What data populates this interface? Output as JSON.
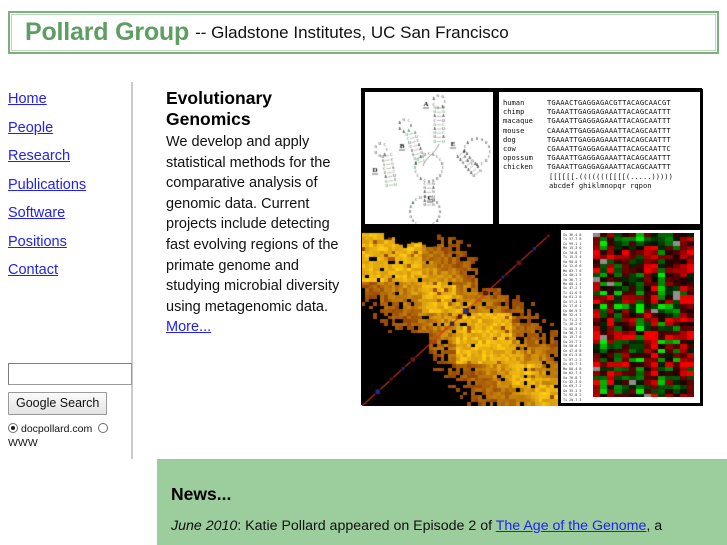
{
  "header": {
    "brand": "Pollard Group",
    "subtitle": "-- Gladstone Institutes, UC San Francisco",
    "border_color": "#7cb07f",
    "brand_color": "#5e9e63"
  },
  "sidebar": {
    "items": [
      {
        "label": "Home",
        "name": "home"
      },
      {
        "label": "People",
        "name": "people"
      },
      {
        "label": "Research",
        "name": "research"
      },
      {
        "label": "Publications",
        "name": "publications"
      },
      {
        "label": "Software",
        "name": "software"
      },
      {
        "label": "Positions",
        "name": "positions"
      },
      {
        "label": "Contact",
        "name": "contact"
      }
    ],
    "link_color": "#2222ee"
  },
  "search": {
    "value": "",
    "placeholder": "",
    "button_label": "Google Search",
    "scope_site_label": "docpollard.com",
    "scope_web_label": "WWW",
    "selected_scope": "docpollard.com"
  },
  "main": {
    "heading": "Evolutionary Genomics",
    "body": "We develop and apply statistical methods for the comparative analysis of genomic data. Current projects include detecting fast evolving regions of the primate genome and studying microbial diversity using metagenomic data.",
    "more_label": "More..."
  },
  "figure": {
    "rna_panel": {
      "caption": "rna-secondary-structure-diagram",
      "stem_labels": [
        "A",
        "B",
        "C",
        "D"
      ]
    },
    "alignment_panel": {
      "rows": [
        {
          "species": "human",
          "sequence": "TGAAACTGAGGAGACGTTACAGCAACGT"
        },
        {
          "species": "chimp",
          "sequence": "TGAAATTGAGGAGAAATTACAGCAATTT"
        },
        {
          "species": "macaque",
          "sequence": "TGAAATTGAGGAGAAATTACAGCAATTT"
        },
        {
          "species": "mouse",
          "sequence": "CAAAATTGAGGAGAAATTACAGCAATTT"
        },
        {
          "species": "dog",
          "sequence": "TGAAATTGAGGAGAAATTACAGCAATTT"
        },
        {
          "species": "cow",
          "sequence": "CGAAATTGAGGAGAAATTACAGCAATTC"
        },
        {
          "species": "opossum",
          "sequence": "TGAAATTGAGGAGAAATTACAGCAATTT"
        },
        {
          "species": "chicken",
          "sequence": "TGAAATTGAGGAGAAATTACAGCAATTT"
        }
      ],
      "structure_line": "[[[[[[.((((((([[[[(.....)))))",
      "key_line": "abcdef ghiklmnopqr      rqpon"
    },
    "heatmap_panel": {
      "caption": "linkage-disequilibrium-heatmap"
    },
    "microarray_panel": {
      "caption": "microarray-expression-heatmap"
    }
  },
  "news": {
    "heading": "News...",
    "date": "June 2010",
    "text_before": ": Katie Pollard appeared on Episode 2 of ",
    "link_label": "The Age of the Genome",
    "text_after": ", a",
    "background_color": "#9ccd9c"
  }
}
